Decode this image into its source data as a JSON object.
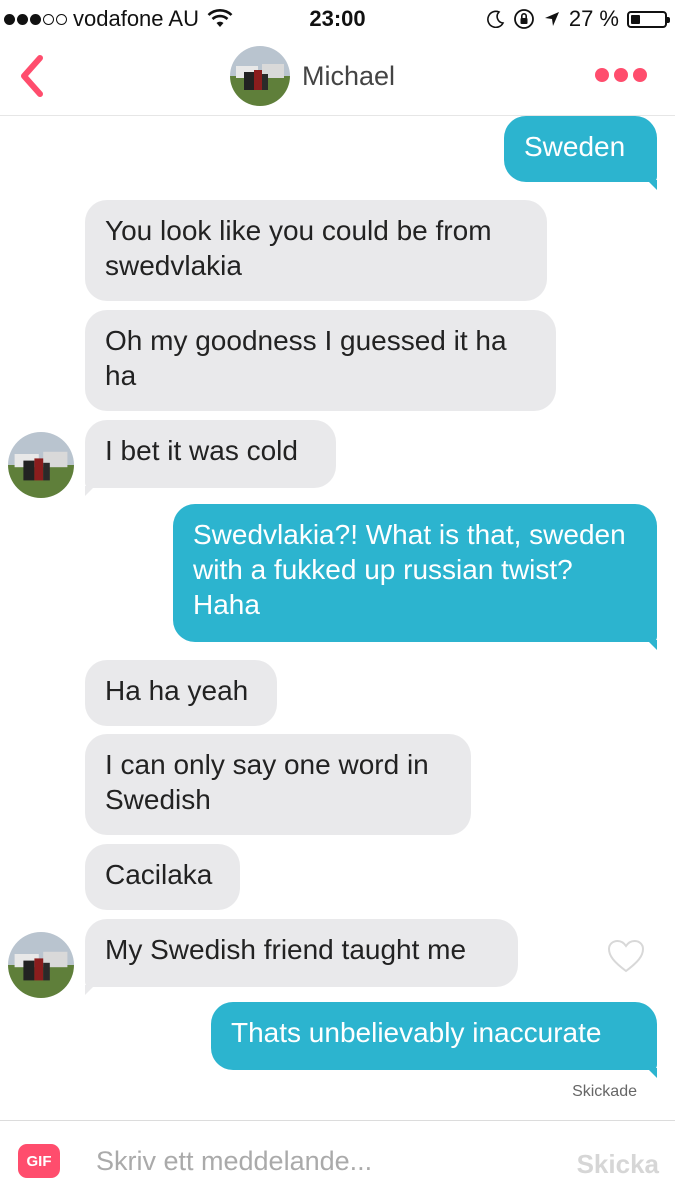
{
  "status_bar": {
    "carrier": "vodafone AU",
    "time": "23:00",
    "battery_percent": "27 %",
    "battery_level": 0.27
  },
  "header": {
    "contact_name": "Michael",
    "back_icon": "chevron-left-icon",
    "menu_icon": "more-dots-icon"
  },
  "messages": [
    {
      "direction": "out",
      "text": "Sweden"
    },
    {
      "direction": "in",
      "text": "You look like you could be from swedvlakia"
    },
    {
      "direction": "in",
      "text": "Oh my goodness I guessed it ha ha"
    },
    {
      "direction": "in",
      "text": "I bet it was cold"
    },
    {
      "direction": "out",
      "text": "Swedvlakia?! What is that, sweden with a fukked up russian twist? Haha"
    },
    {
      "direction": "in",
      "text": "Ha ha yeah"
    },
    {
      "direction": "in",
      "text": "I can only say one word in Swedish"
    },
    {
      "direction": "in",
      "text": "Cacilaka"
    },
    {
      "direction": "in",
      "text": "My Swedish friend taught me"
    },
    {
      "direction": "out",
      "text": "Thats unbelievably inaccurate"
    }
  ],
  "sent_status": "Skickade",
  "composer": {
    "gif_label": "GIF",
    "placeholder": "Skriv ett meddelande...",
    "send_label": "Skicka"
  },
  "colors": {
    "accent": "#ff4d6d",
    "outgoing_bubble": "#2cb4cf",
    "incoming_bubble": "#e9e9eb"
  }
}
